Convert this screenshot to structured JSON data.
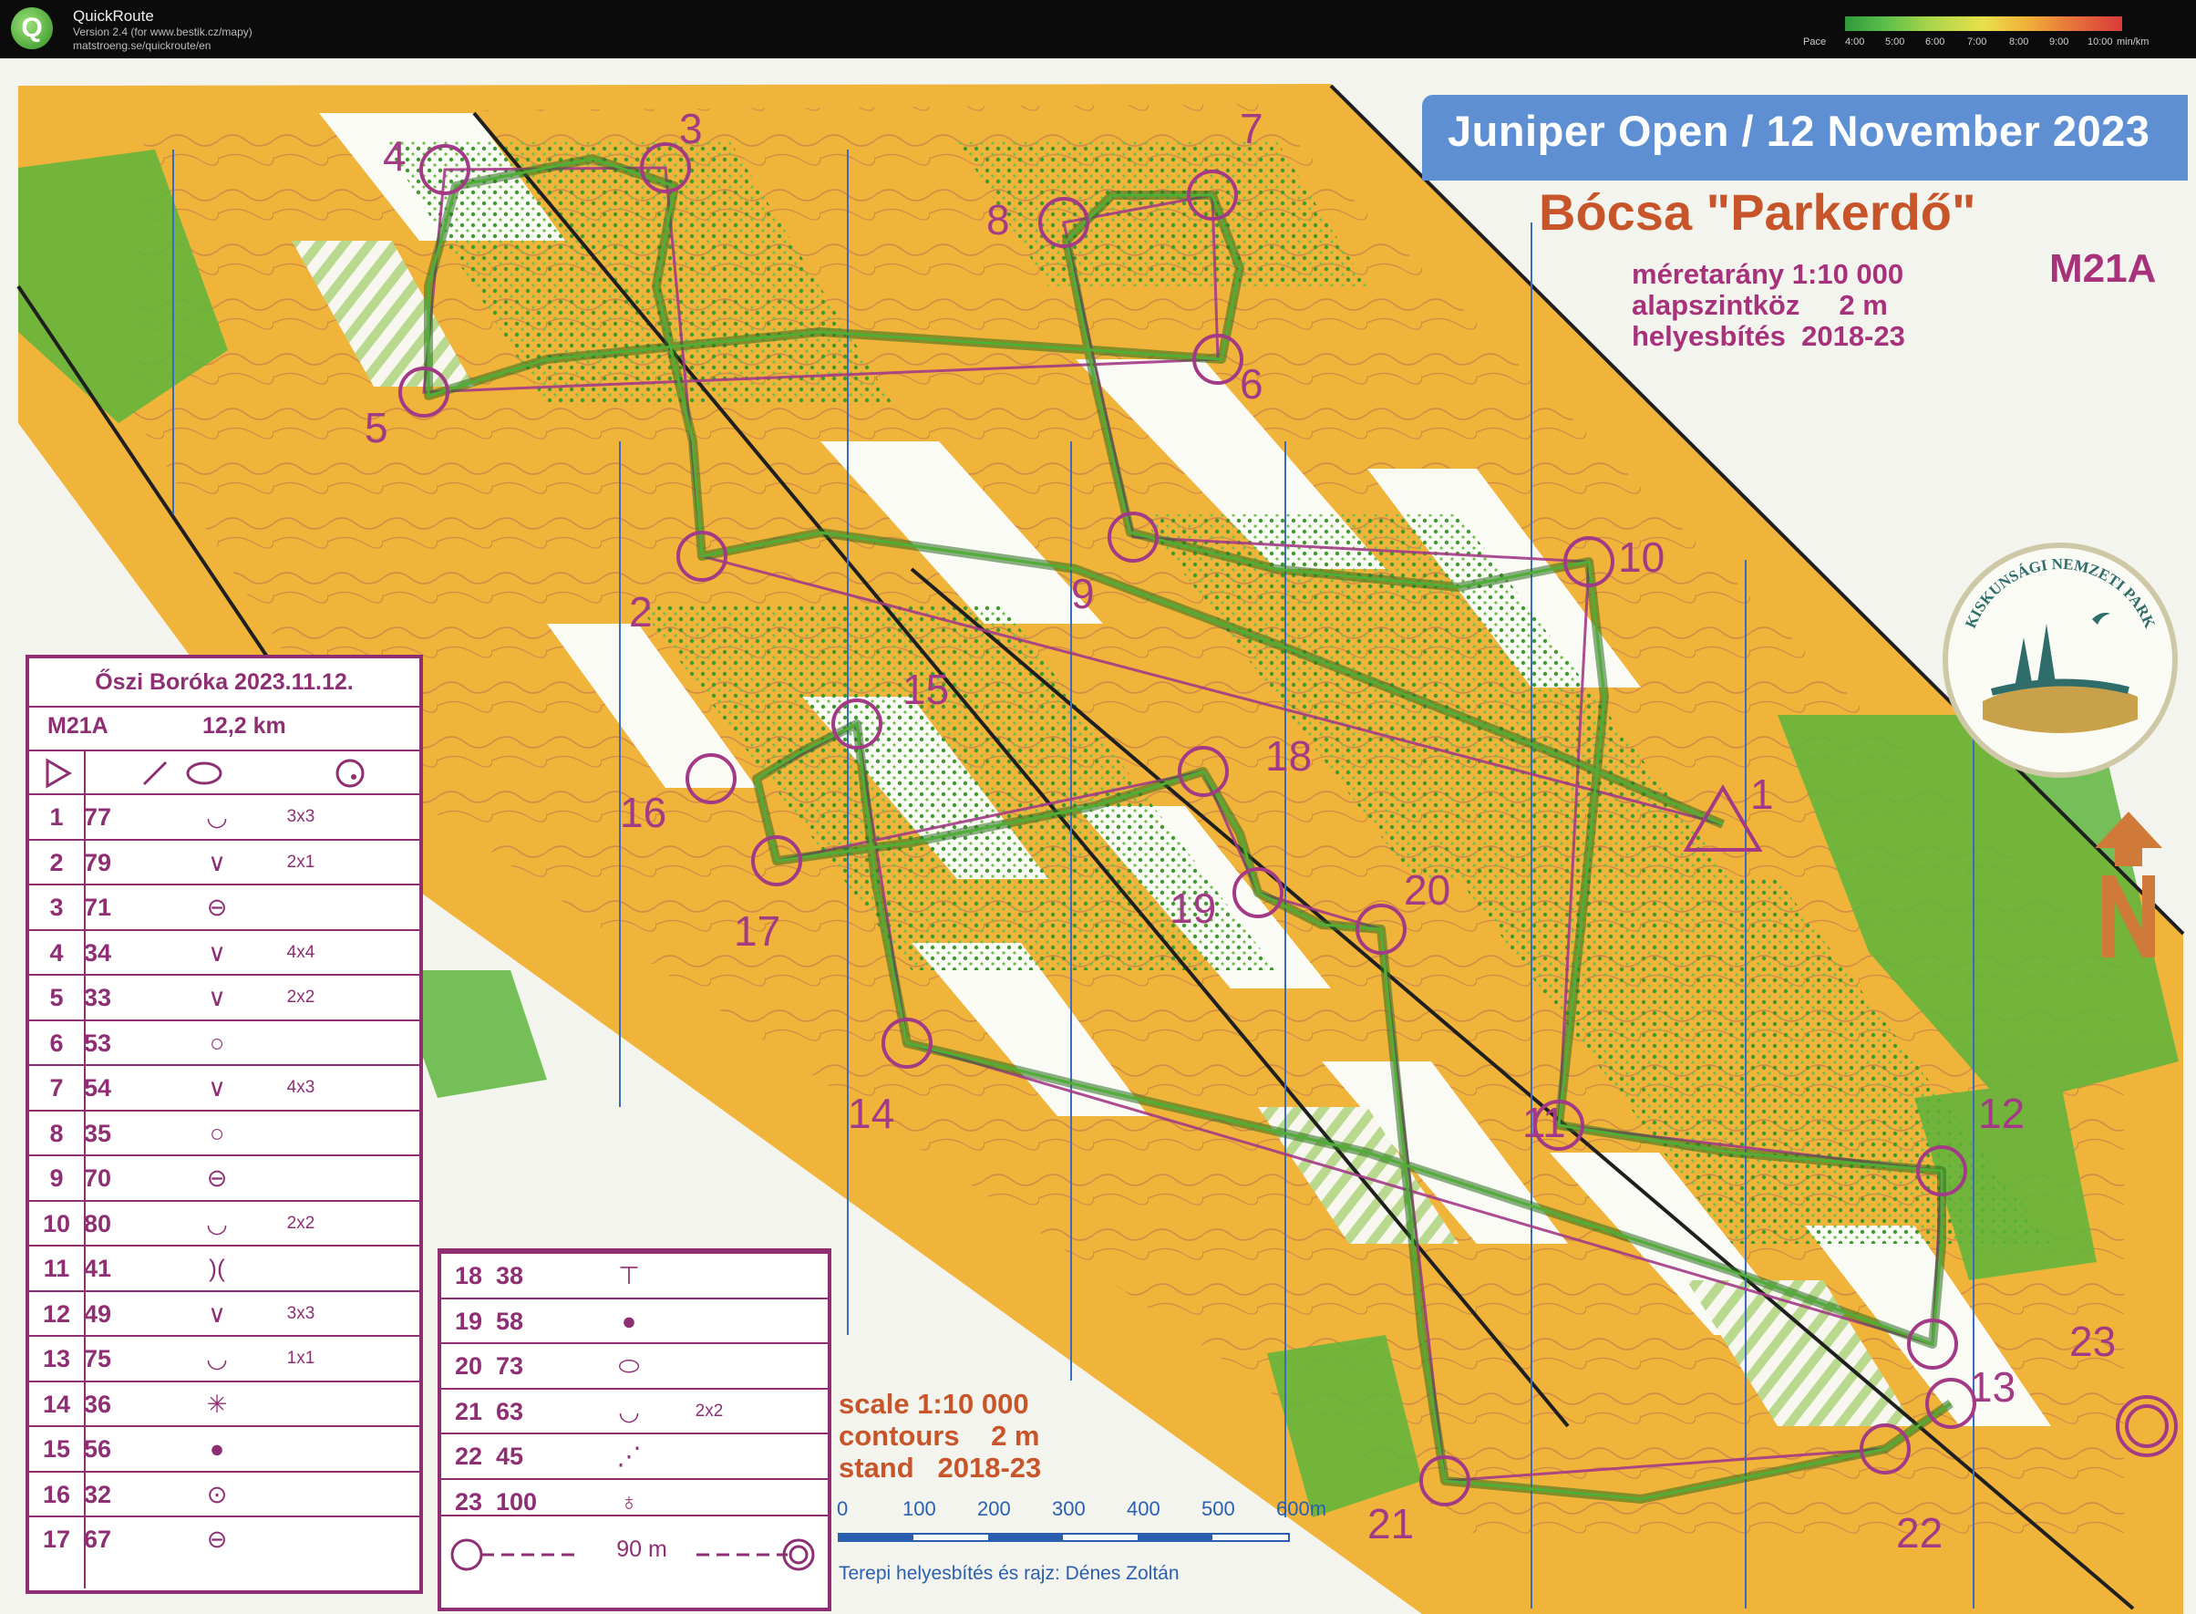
{
  "app": {
    "name": "QuickRoute",
    "version": "Version 2.4  (for www.bestik.cz/mapy)",
    "url": "matstroeng.se/quickroute/en",
    "pace_label": "Pace",
    "pace_ticks": [
      "4:00",
      "5:00",
      "6:00",
      "7:00",
      "8:00",
      "9:00",
      "10:00",
      "min/km"
    ]
  },
  "map": {
    "banner": "Juniper Open / 12 November 2023",
    "title": "Bócsa \"Parkerdő\"",
    "info": [
      "méretarány 1:10 000",
      "alapszintköz     2 m",
      "helyesbítés  2018-23"
    ],
    "class": "M21A",
    "park_logo_text": "KISKUNSÁGI NEMZETI PARK",
    "scale_info": [
      "scale 1:10 000",
      "contours    2 m",
      "stand   2018-23"
    ],
    "scale_bar_ticks": [
      "0",
      "100",
      "200",
      "300",
      "400",
      "500",
      "600m"
    ],
    "credit": "Terepi helyesbítés és rajz: Dénes Zoltán",
    "control_numbers": [
      "1",
      "2",
      "3",
      "4",
      "5",
      "6",
      "7",
      "8",
      "9",
      "10",
      "11",
      "12",
      "13",
      "14",
      "15",
      "16",
      "17",
      "18",
      "19",
      "20",
      "21",
      "22",
      "23"
    ]
  },
  "description_sheet": {
    "title": "Őszi Boróka 2023.11.12.",
    "class": "M21A",
    "length": "12,2 km",
    "rows": [
      {
        "n": "1",
        "code": "77",
        "dim": "3x3"
      },
      {
        "n": "2",
        "code": "79",
        "dim": "2x1"
      },
      {
        "n": "3",
        "code": "71",
        "dim": ""
      },
      {
        "n": "4",
        "code": "34",
        "dim": "4x4"
      },
      {
        "n": "5",
        "code": "33",
        "dim": "2x2"
      },
      {
        "n": "6",
        "code": "53",
        "dim": ""
      },
      {
        "n": "7",
        "code": "54",
        "dim": "4x3"
      },
      {
        "n": "8",
        "code": "35",
        "dim": ""
      },
      {
        "n": "9",
        "code": "70",
        "dim": ""
      },
      {
        "n": "10",
        "code": "80",
        "dim": "2x2"
      },
      {
        "n": "11",
        "code": "41",
        "dim": ""
      },
      {
        "n": "12",
        "code": "49",
        "dim": "3x3"
      },
      {
        "n": "13",
        "code": "75",
        "dim": "1x1"
      },
      {
        "n": "14",
        "code": "36",
        "dim": ""
      },
      {
        "n": "15",
        "code": "56",
        "dim": ""
      },
      {
        "n": "16",
        "code": "32",
        "dim": ""
      },
      {
        "n": "17",
        "code": "67",
        "dim": ""
      }
    ],
    "rows2": [
      {
        "n": "18",
        "code": "38",
        "dim": ""
      },
      {
        "n": "19",
        "code": "58",
        "dim": ""
      },
      {
        "n": "20",
        "code": "73",
        "dim": ""
      },
      {
        "n": "21",
        "code": "63",
        "dim": "2x2"
      },
      {
        "n": "22",
        "code": "45",
        "dim": ""
      },
      {
        "n": "23",
        "code": "100",
        "dim": ""
      }
    ],
    "finish_distance": "90 m"
  },
  "colors": {
    "banner": "#5e8fd3",
    "title": "#c8552a",
    "purple": "#a33a86",
    "route": "#2f7a22",
    "yellow": "#f0b732",
    "green": "#5db53c"
  }
}
